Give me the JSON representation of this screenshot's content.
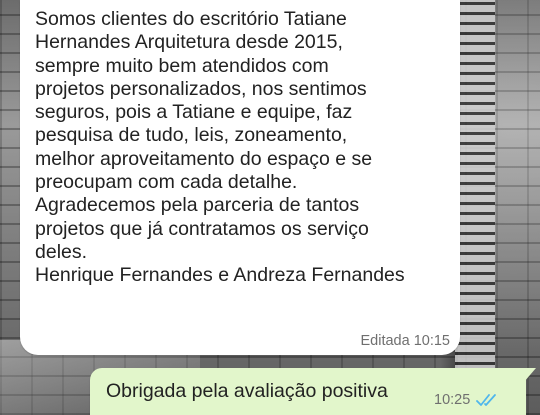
{
  "conversation": {
    "incoming_message": {
      "text": "Somos clientes do escritório Tatiane\nHernandes Arquitetura desde 2015,\nsempre muito bem atendidos com\nprojetos personalizados, nos sentimos\nseguros, pois a Tatiane e equipe, faz\npesquisa de tudo, leis, zoneamento,\nmelhor aproveitamento do espaço e se\npreocupam com cada detalhe.\nAgradecemos pela parceria de tantos\nprojetos que já contratamos os serviço\ndeles.\nHenrique Fernandes e Andreza Fernandes",
      "meta": "Editada 10:15"
    },
    "outgoing_message": {
      "text": "Obrigada pela avaliação positiva",
      "time": "10:25",
      "status_icon": "double-check-read-icon"
    }
  },
  "colors": {
    "incoming_bubble": "#ffffff",
    "outgoing_bubble": "#e2f6cb",
    "read_ticks": "#4fb6ec",
    "text": "#222222",
    "meta_text": "#6f6f6f"
  }
}
